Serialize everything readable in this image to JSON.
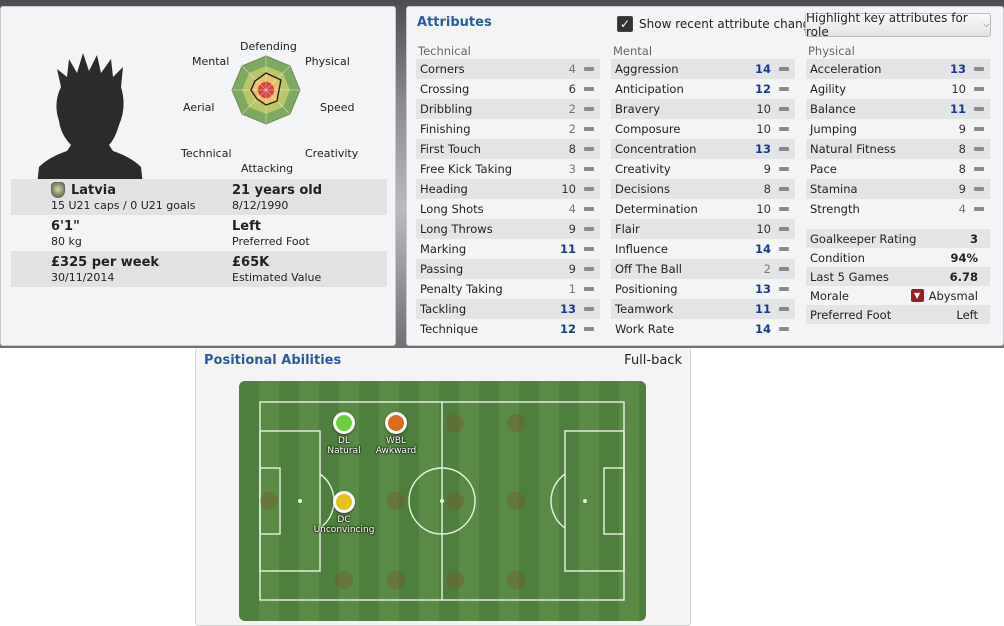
{
  "profile": {
    "radar_labels": {
      "defending": "Defending",
      "mental": "Mental",
      "physical": "Physical",
      "aerial": "Aerial",
      "speed": "Speed",
      "technical": "Technical",
      "creativity": "Creativity",
      "attacking": "Attacking"
    },
    "nationality": "Latvia",
    "caps": "15 U21 caps / 0 U21 goals",
    "age": "21 years old",
    "dob": "8/12/1990",
    "height": "6'1\"",
    "weight": "80 kg",
    "preferred_foot": "Left",
    "preferred_foot_label": "Preferred Foot",
    "wage": "£325 per week",
    "contract_end": "30/11/2014",
    "value": "£65K",
    "value_label": "Estimated Value"
  },
  "attributes": {
    "title": "Attributes",
    "show_changes_label": "Show recent attribute changes",
    "show_changes_checked": true,
    "highlight_button": "Highlight key attributes for role",
    "technical": {
      "heading": "Technical",
      "items": [
        {
          "name": "Corners",
          "value": "4",
          "style": "grey"
        },
        {
          "name": "Crossing",
          "value": "6",
          "style": "dark"
        },
        {
          "name": "Dribbling",
          "value": "2",
          "style": "grey"
        },
        {
          "name": "Finishing",
          "value": "2",
          "style": "grey"
        },
        {
          "name": "First Touch",
          "value": "8",
          "style": "dark"
        },
        {
          "name": "Free Kick Taking",
          "value": "3",
          "style": "grey"
        },
        {
          "name": "Heading",
          "value": "10",
          "style": "dark"
        },
        {
          "name": "Long Shots",
          "value": "4",
          "style": "grey"
        },
        {
          "name": "Long Throws",
          "value": "9",
          "style": "dark"
        },
        {
          "name": "Marking",
          "value": "11",
          "style": "blue"
        },
        {
          "name": "Passing",
          "value": "9",
          "style": "dark"
        },
        {
          "name": "Penalty Taking",
          "value": "1",
          "style": "grey"
        },
        {
          "name": "Tackling",
          "value": "13",
          "style": "blue"
        },
        {
          "name": "Technique",
          "value": "12",
          "style": "blue"
        }
      ]
    },
    "mental": {
      "heading": "Mental",
      "items": [
        {
          "name": "Aggression",
          "value": "14",
          "style": "blue"
        },
        {
          "name": "Anticipation",
          "value": "12",
          "style": "blue"
        },
        {
          "name": "Bravery",
          "value": "10",
          "style": "dark"
        },
        {
          "name": "Composure",
          "value": "10",
          "style": "dark"
        },
        {
          "name": "Concentration",
          "value": "13",
          "style": "blue"
        },
        {
          "name": "Creativity",
          "value": "9",
          "style": "dark"
        },
        {
          "name": "Decisions",
          "value": "8",
          "style": "dark"
        },
        {
          "name": "Determination",
          "value": "10",
          "style": "dark"
        },
        {
          "name": "Flair",
          "value": "10",
          "style": "dark"
        },
        {
          "name": "Influence",
          "value": "14",
          "style": "blue"
        },
        {
          "name": "Off The Ball",
          "value": "2",
          "style": "grey"
        },
        {
          "name": "Positioning",
          "value": "13",
          "style": "blue"
        },
        {
          "name": "Teamwork",
          "value": "11",
          "style": "blue"
        },
        {
          "name": "Work Rate",
          "value": "14",
          "style": "blue"
        }
      ]
    },
    "physical": {
      "heading": "Physical",
      "items": [
        {
          "name": "Acceleration",
          "value": "13",
          "style": "blue"
        },
        {
          "name": "Agility",
          "value": "10",
          "style": "dark"
        },
        {
          "name": "Balance",
          "value": "11",
          "style": "blue"
        },
        {
          "name": "Jumping",
          "value": "9",
          "style": "dark"
        },
        {
          "name": "Natural Fitness",
          "value": "8",
          "style": "dark"
        },
        {
          "name": "Pace",
          "value": "8",
          "style": "dark"
        },
        {
          "name": "Stamina",
          "value": "9",
          "style": "dark"
        },
        {
          "name": "Strength",
          "value": "4",
          "style": "grey"
        }
      ]
    },
    "extra": {
      "goalkeeper_rating_label": "Goalkeeper Rating",
      "goalkeeper_rating": "3",
      "condition_label": "Condition",
      "condition": "94%",
      "last5_label": "Last 5 Games",
      "last5": "6.78",
      "morale_label": "Morale",
      "morale": "Abysmal",
      "pref_foot_label": "Preferred Foot",
      "pref_foot": "Left"
    }
  },
  "positional": {
    "title": "Positional Abilities",
    "role": "Full-back",
    "positions": [
      {
        "code": "DL",
        "rating": "Natural",
        "color": "#6ad03a"
      },
      {
        "code": "WBL",
        "rating": "Awkward",
        "color": "#e06a1c"
      },
      {
        "code": "DC",
        "rating": "Unconvincing",
        "color": "#e8c21c"
      }
    ]
  },
  "colors": {
    "accent_title": "#2c5aa0",
    "key_attribute": "#1a3a8a",
    "pitch_green": "#4f7f3e"
  }
}
